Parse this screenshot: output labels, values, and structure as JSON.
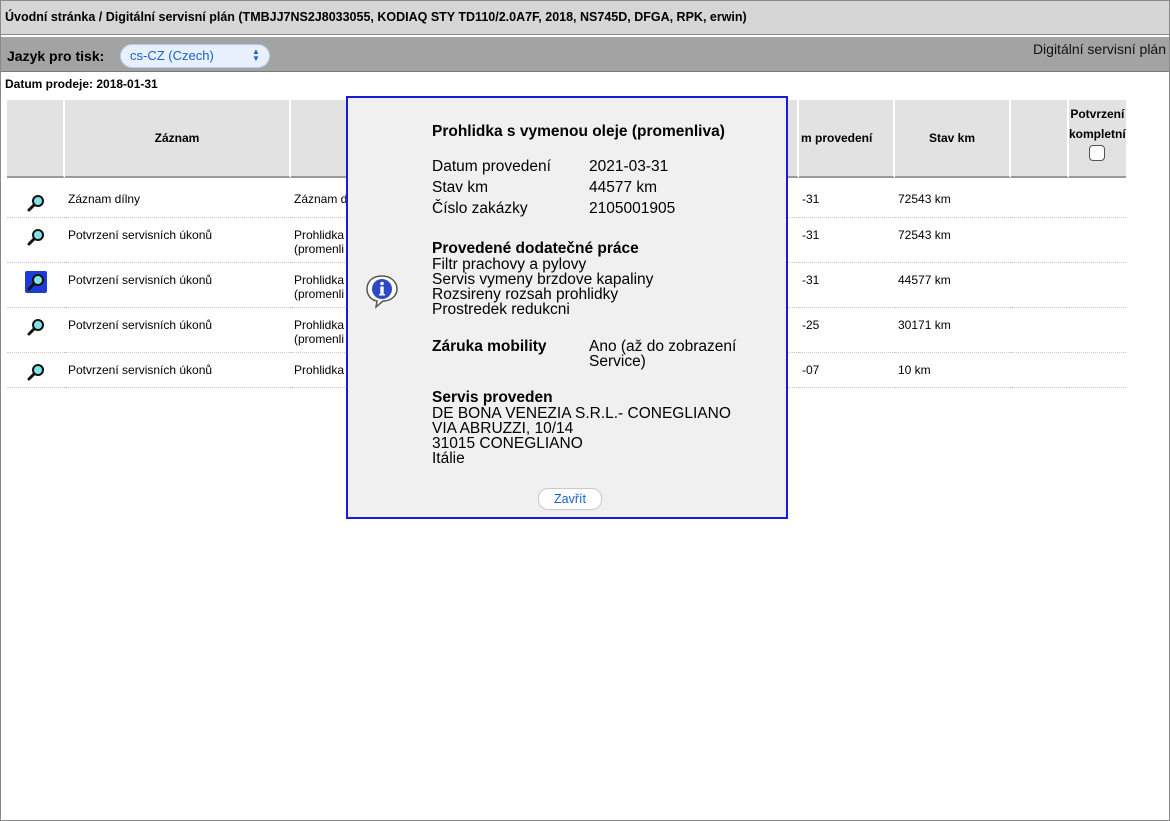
{
  "breadcrumb": "Úvodní stránka / Digitální servisní plán (TMBJJ7NS2J8033055, KODIAQ STY TD110/2.0A7F, 2018, NS745D, DFGA, RPK, erwin)",
  "language_bar": {
    "label": "Jazyk pro tisk:",
    "selected": "cs-CZ (Czech)",
    "app_title": "Digitální servisní plán"
  },
  "sale_date": "Datum prodeje: 2018-01-31",
  "table": {
    "headers": {
      "record": "Záznam",
      "date_partial": "m provedení",
      "mileage": "Stav km",
      "confirm_line1": "Potvrzení",
      "confirm_line2": "kompletní"
    },
    "rows": [
      {
        "record": "Záznam dílny",
        "detail": "Záznam d",
        "detail2": "",
        "date": "-31",
        "km": "72543 km"
      },
      {
        "record": "Potvrzení servisních úkonů",
        "detail": "Prohlidka",
        "detail2": "(promenli",
        "date": "-31",
        "km": "72543 km"
      },
      {
        "record": "Potvrzení servisních úkonů",
        "detail": "Prohlidka",
        "detail2": "(promenli",
        "date": "-31",
        "km": "44577 km"
      },
      {
        "record": "Potvrzení servisních úkonů",
        "detail": "Prohlidka",
        "detail2": "(promenli",
        "date": "-25",
        "km": "30171 km"
      },
      {
        "record": "Potvrzení servisních úkonů",
        "detail": "Prohlidka",
        "detail2": "",
        "date": "-07",
        "km": "10 km"
      }
    ]
  },
  "dialog": {
    "title": "Prohlidka s vymenou oleje (promenliva)",
    "fields": [
      {
        "label": "Datum provedení",
        "value": "2021-03-31"
      },
      {
        "label": "Stav km",
        "value": "44577 km"
      },
      {
        "label": "Číslo zakázky",
        "value": "2105001905"
      }
    ],
    "extra_work_head": "Provedené dodatečné práce",
    "extra_work": [
      "Filtr prachovy a pylovy",
      "Servis vymeny brzdove kapaliny",
      "Rozsireny rozsah prohlidky",
      "Prostredek redukcni"
    ],
    "mobility_label": "Záruka mobility",
    "mobility_value_1": "Ano (až do zobrazení",
    "mobility_value_2": "Service)",
    "service_head": "Servis proveden",
    "service_lines": [
      "DE BONA VENEZIA S.R.L.- CONEGLIANO",
      "VIA ABRUZZI, 10/14",
      "31015 CONEGLIANO",
      "Itálie"
    ],
    "close_label": "Zavřít"
  }
}
